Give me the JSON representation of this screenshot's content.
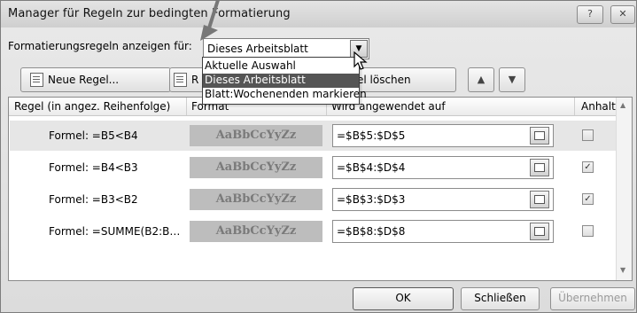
{
  "window": {
    "title": "Manager für Regeln zur bedingten Formatierung",
    "help_glyph": "?",
    "close_glyph": "✕"
  },
  "show_rules": {
    "label": "Formatierungsregeln anzeigen für:",
    "selected": "Dieses Arbeitsblatt",
    "options": [
      "Aktuelle Auswahl",
      "Dieses Arbeitsblatt",
      "Blatt:Wochenenden markieren"
    ],
    "highlighted_index": 1
  },
  "toolbar": {
    "new_rule": "Neue Regel...",
    "edit_rule_partial": "R",
    "delete_rule": "egel löschen",
    "up_glyph": "▲",
    "down_glyph": "▼"
  },
  "table": {
    "columns": [
      "Regel (in angez. Reihenfolge)",
      "Format",
      "Wird angewendet auf",
      "Anhalten"
    ],
    "rows": [
      {
        "rule": "Formel: =B5<B4",
        "preview": "AaBbCcYyZz",
        "applies_to": "=$B$5:$D$5",
        "stop": false,
        "selected": true
      },
      {
        "rule": "Formel: =B4<B3",
        "preview": "AaBbCcYyZz",
        "applies_to": "=$B$4:$D$4",
        "stop": true,
        "selected": false
      },
      {
        "rule": "Formel: =B3<B2",
        "preview": "AaBbCcYyZz",
        "applies_to": "=$B$3:$D$3",
        "stop": true,
        "selected": false
      },
      {
        "rule": "Formel: =SUMME(B2:B…",
        "preview": "AaBbCcYyZz",
        "applies_to": "=$B$8:$D$8",
        "stop": false,
        "selected": false
      }
    ]
  },
  "buttons": {
    "ok": "OK",
    "close": "Schließen",
    "apply": "Übernehmen"
  },
  "icons": {
    "new_rule": "new-document-icon",
    "ref": "range-selector-icon",
    "cursor": "mouse-pointer-icon",
    "callout": "arrow-pointer-icon"
  }
}
